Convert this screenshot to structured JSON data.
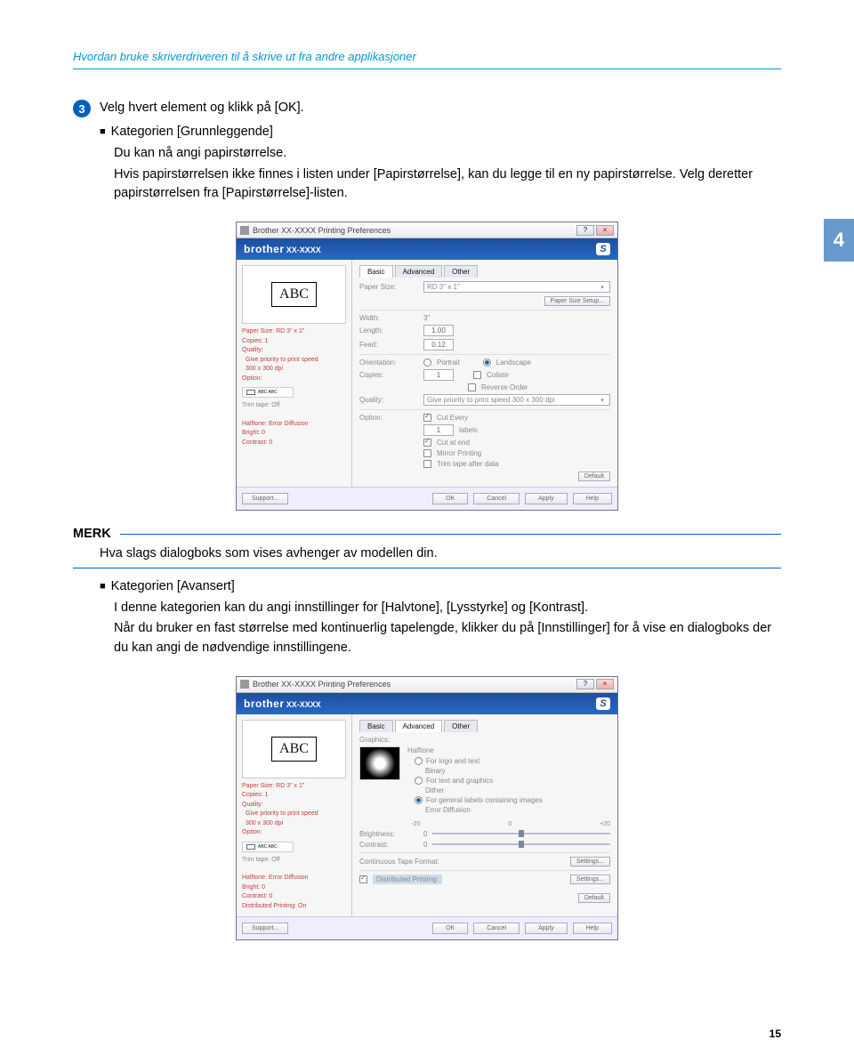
{
  "header_title": "Hvordan bruke skriverdriveren til å skrive ut fra andre applikasjoner",
  "side_tab": "4",
  "step": {
    "num": "3",
    "text": "Velg hvert element og klikk på [OK]."
  },
  "bullet1_title": "Kategorien [Grunnleggende]",
  "bullet1_sub1": "Du kan nå angi papirstørrelse.",
  "bullet1_sub2": "Hvis papirstørrelsen ikke finnes i listen under [Papirstørrelse], kan du legge til en ny papirstørrelse. Velg deretter papirstørrelsen fra [Papirstørrelse]-listen.",
  "note_title": "MERK",
  "note_body": "Hva slags dialogboks som vises avhenger av modellen din.",
  "bullet2_title": "Kategorien [Avansert]",
  "bullet2_sub1": "I denne kategorien kan du angi innstillinger for [Halvtone], [Lysstyrke] og [Kontrast].",
  "bullet2_sub2": "Når du bruker en fast størrelse med kontinuerlig tapelengde, klikker du på [Innstillinger] for å vise en dialogboks der du kan angi de nødvendige innstillingene.",
  "page_number": "15",
  "dlg": {
    "titlebar": "Brother XX-XXXX Printing Preferences",
    "brand": "brother",
    "model": "XX-XXXX",
    "preview_text": "ABC",
    "left_info": {
      "paper_size": "Paper Size: RD 3\" x 1\"",
      "copies": "Copies: 1",
      "quality": "Quality:",
      "quality_detail": "Give priority to print speed",
      "dpi": "300 x 300 dpi",
      "option": "Option:",
      "option_mini": "ABC  ABC",
      "trim": "Trim tape: Off",
      "halftone": "Halftone: Error Diffusion",
      "bright": "Bright: 0",
      "contrast": "Contrast: 0",
      "dist": "Distributed Printing: On"
    },
    "tabs": {
      "basic": "Basic",
      "advanced": "Advanced",
      "other": "Other"
    },
    "basic": {
      "paper_size_label": "Paper Size:",
      "paper_size_value": "RD 3\" x 1\"",
      "paper_size_setup": "Paper Size Setup...",
      "width_label": "Width:",
      "width_value": "3\"",
      "length_label": "Length:",
      "length_value": "1.00",
      "feed_label": "Feed:",
      "feed_value": "0.12",
      "orientation_label": "Orientation:",
      "orient_portrait": "Portrait",
      "orient_landscape": "Landscape",
      "copies_label": "Copies:",
      "copies_value": "1",
      "collate": "Collate",
      "reverse": "Reverse Order",
      "quality_label": "Quality:",
      "quality_value": "Give priority to print speed 300 x 300 dpi",
      "option_label": "Option:",
      "cut_every": "Cut Every",
      "cut_every_value": "1",
      "cut_every_unit": "labels",
      "cut_at_end": "Cut at end",
      "mirror": "Mirror Printing",
      "trim_after": "Trim tape after data",
      "default_btn": "Default"
    },
    "advanced": {
      "graphics": "Graphics:",
      "halftone_label": "Halftone",
      "opt_logo": "For logo and text",
      "opt_binary": "Binary",
      "opt_text_graphics": "For text and graphics",
      "opt_dither": "Dither",
      "opt_general": "For general labels containing images",
      "opt_error_diff": "Error Diffusion",
      "scale_left": "-20",
      "scale_mid": "0",
      "scale_right": "+20",
      "brightness_label": "Brightness:",
      "brightness_value": "0",
      "contrast_label": "Contrast:",
      "contrast_value": "0",
      "ctf_label": "Continuous Tape Format:",
      "settings_btn": "Settings...",
      "dist_print": "Distributed Printing:",
      "dist_settings": "Settings..."
    },
    "footer": {
      "support": "Support...",
      "ok": "OK",
      "cancel": "Cancel",
      "apply": "Apply",
      "help": "Help"
    }
  }
}
